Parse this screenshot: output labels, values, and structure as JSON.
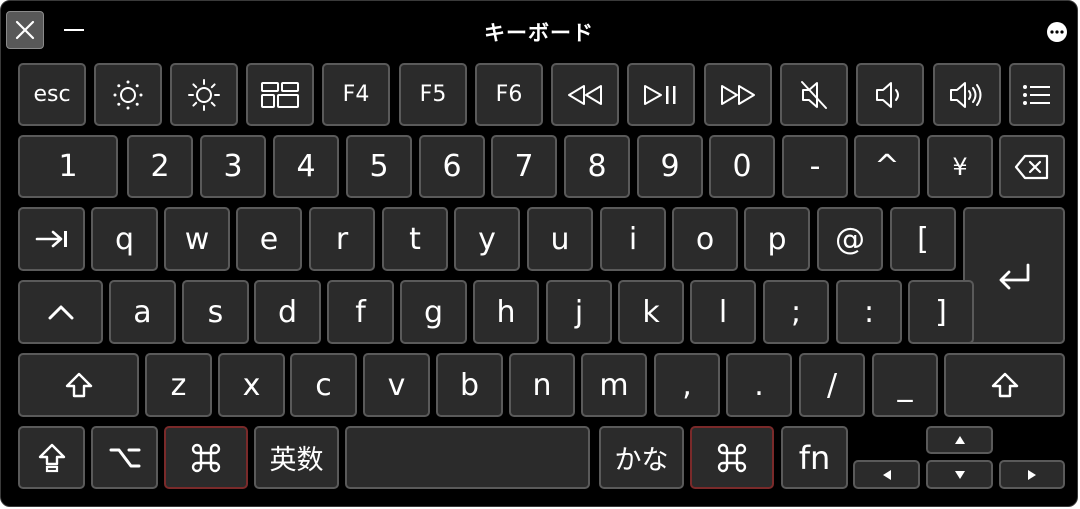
{
  "window": {
    "title": "キーボード",
    "close_icon": "close-x-icon",
    "minimize_icon": "minimize-dash-icon",
    "more_icon": "ellipsis-circle-icon"
  },
  "function_row": {
    "esc": "esc",
    "brightness_down_icon": "brightness-down-icon",
    "brightness_up_icon": "brightness-up-icon",
    "mission_control_icon": "mission-control-icon",
    "f4": "F4",
    "f5": "F5",
    "f6": "F6",
    "rewind_icon": "rewind-icon",
    "play_pause_icon": "play-pause-icon",
    "fast_forward_icon": "fast-forward-icon",
    "mute_icon": "mute-icon",
    "volume_down_icon": "volume-down-icon",
    "volume_up_icon": "volume-up-icon",
    "menu_icon": "list-icon"
  },
  "number_row": [
    "1",
    "2",
    "3",
    "4",
    "5",
    "6",
    "7",
    "8",
    "9",
    "0",
    "-",
    "^",
    "¥"
  ],
  "qwerty_row": [
    "q",
    "w",
    "e",
    "r",
    "t",
    "y",
    "u",
    "i",
    "o",
    "p",
    "@",
    "["
  ],
  "home_row": [
    "a",
    "s",
    "d",
    "f",
    "g",
    "h",
    "j",
    "k",
    "l",
    ";",
    ":",
    "]"
  ],
  "bottom_letter_row": [
    "z",
    "x",
    "c",
    "v",
    "b",
    "n",
    "m",
    ",",
    ".",
    "/",
    "_"
  ],
  "modifier_row": {
    "eisu": "英数",
    "kana": "かな",
    "fn": "fn"
  },
  "colors": {
    "background": "#000000",
    "key_fill": "#2b2b2b",
    "key_border": "#5a5a5a",
    "key_border_pressed": "#7a2a2a",
    "close_button": "#585858"
  }
}
